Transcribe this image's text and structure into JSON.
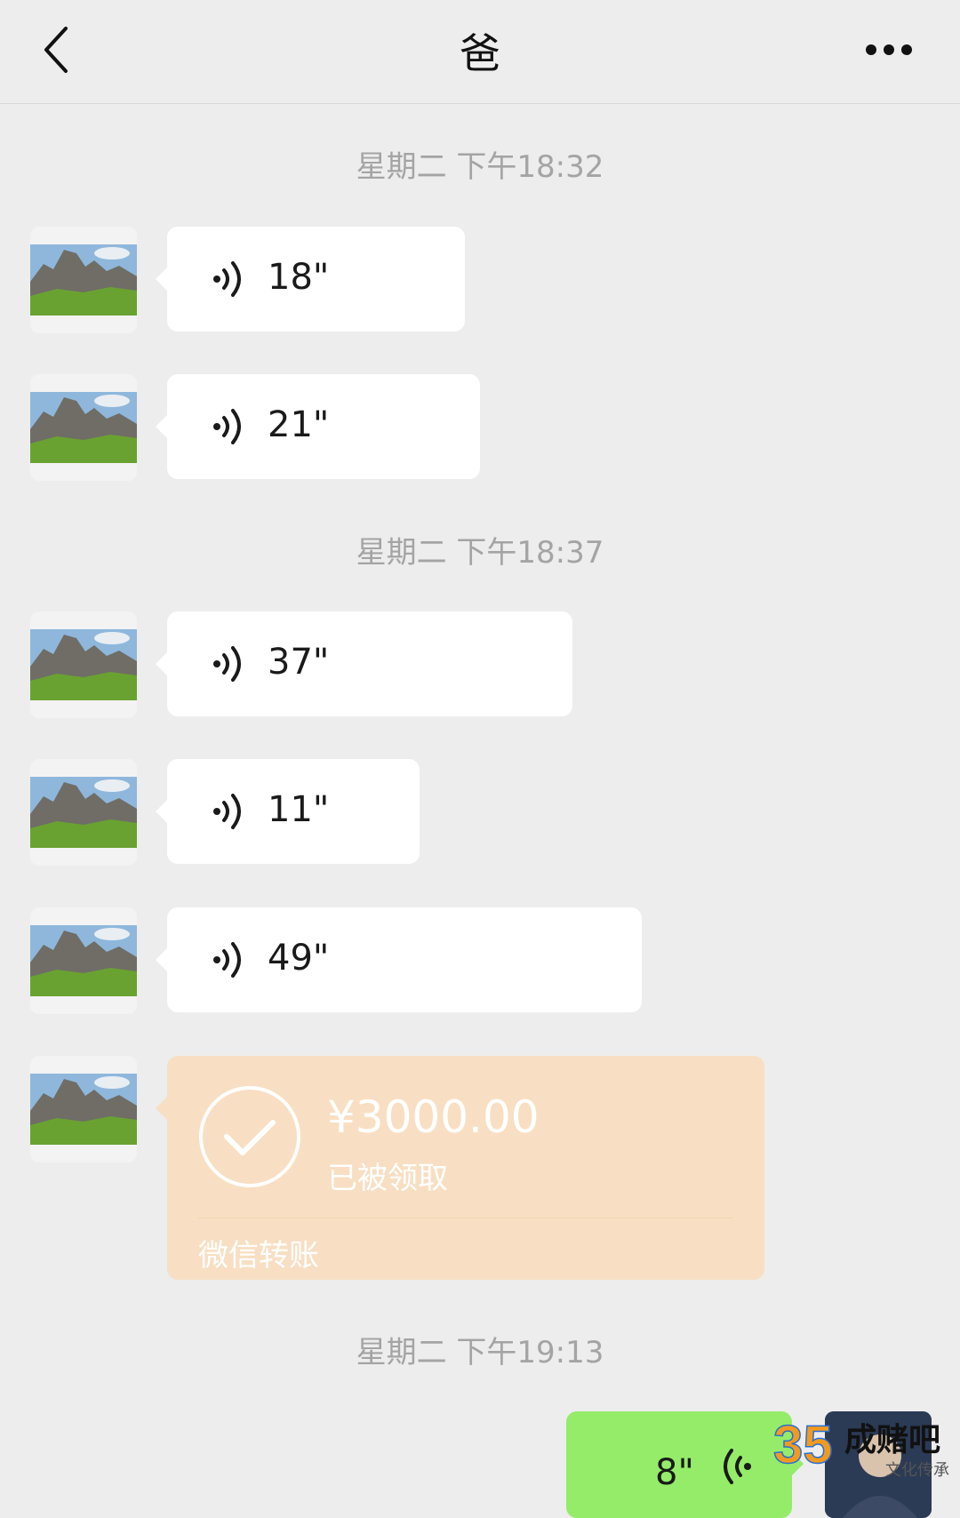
{
  "header": {
    "title": "爸",
    "back_icon": "chevron-left-icon",
    "more_icon": "ellipsis-icon"
  },
  "messages": {
    "ts1": "星期二 下午18:32",
    "voice1": "18\"",
    "voice2": "21\"",
    "ts2": "星期二 下午18:37",
    "voice3": "37\"",
    "voice4": "11\"",
    "voice5": "49\"",
    "transfer": {
      "amount": "¥3000.00",
      "status": "已被领取",
      "footer": "微信转账"
    },
    "ts3": "星期二 下午19:13",
    "my_voice": "8\""
  },
  "watermark": {
    "number": "35",
    "brand": "成赌吧",
    "tagline": "文化传承"
  },
  "colors": {
    "background": "#ededed",
    "transfer_bubble": "#f8dfc3",
    "self_bubble": "#95ec69",
    "timestamp_text": "#a4a4a4"
  }
}
